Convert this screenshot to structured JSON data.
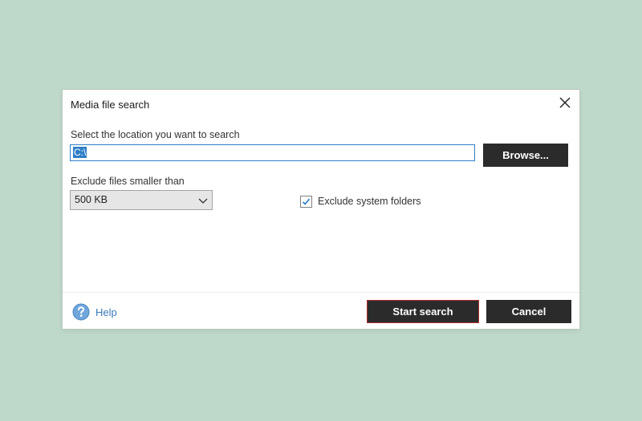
{
  "dialog": {
    "title": "Media file search",
    "location_label": "Select the location you want to search",
    "location_value": "C:\\",
    "browse_label": "Browse...",
    "exclude_label": "Exclude files smaller than",
    "size_selected": "500 KB",
    "exclude_system_label": "Exclude system folders",
    "exclude_system_checked": true,
    "help_label": "Help",
    "start_label": "Start search",
    "cancel_label": "Cancel"
  },
  "colors": {
    "background": "#bed8c9",
    "button_dark": "#2b2b2b",
    "accent_blue": "#2f7fc7",
    "start_border": "#b03030"
  },
  "icons": {
    "close": "close-icon",
    "dropdown": "chevron-down-icon",
    "check": "checkmark-icon",
    "help": "help-question-icon"
  }
}
